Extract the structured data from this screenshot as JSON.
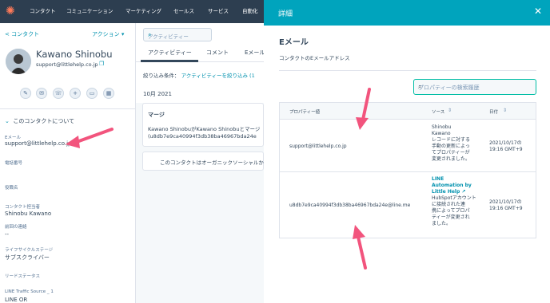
{
  "topnav": {
    "items": [
      "コンタクト",
      "コミュニケーション",
      "マーケティング",
      "セールス",
      "サービス",
      "自動化"
    ]
  },
  "sidebar": {
    "back_label": "< コンタクト",
    "actions_label": "アクション ▾",
    "contact_name": "Kawano Shinobu",
    "contact_email": "support@littlehelp.co.jp",
    "about_title": "このコンタクトについて",
    "fields": [
      {
        "label": "Eメール",
        "value": "support@littlehelp.co.jp"
      },
      {
        "label": "電話番号",
        "value": ""
      },
      {
        "label": "役職名",
        "value": ""
      },
      {
        "label": "コンタクト担当者",
        "value": "Shinobu Kawano"
      },
      {
        "label": "前回の連絡",
        "value": "--"
      },
      {
        "label": "ライフサイクルステージ",
        "value": "サブスクライバー"
      },
      {
        "label": "リードステータス",
        "value": ""
      },
      {
        "label": "LINE Traffic Source _ 1",
        "value": "LINE OR"
      }
    ]
  },
  "middle": {
    "search_placeholder": "アクティビティー",
    "tabs": [
      "アクティビティー",
      "コメント",
      "Eメール"
    ],
    "filter_prefix": "絞り込み条件：",
    "filter_link": "アクティビティーを絞り込み (1",
    "month": "10月 2021",
    "card1_title": "マージ",
    "card1_line1": "Kawano ShinobuがKawano Shinobuとマージ",
    "card1_line2": "(u8db7e9ca40994f3db38ba46967bda24e",
    "card2_text": "このコンタクトはオーガニックソーシャルか"
  },
  "panel": {
    "title": "詳細",
    "section_title": "Eメール",
    "section_desc": "コンタクトのEメールアドレス",
    "history_search_placeholder": "プロパティーの検索履歴",
    "headers": {
      "value": "プロパティー値",
      "source": "ソース",
      "date": "日付"
    },
    "rows": [
      {
        "value": "support@littlehelp.co.jp",
        "source_lines": [
          "Shinobu",
          "Kawano",
          "レコードに対する",
          "手動の更新によっ",
          "てプロパティーが",
          "変更されました。"
        ],
        "date_lines": [
          "2021/10/17の",
          "19:16 GMT+9"
        ]
      },
      {
        "value": "u8db7e9ca40994f3db38ba46967bda24e@line.me",
        "source_link_lines": [
          "LINE",
          "Automation by",
          "Little Help ↗"
        ],
        "source_lines": [
          "HubSpotアカウント",
          "に接続された連",
          "携によってプロパ",
          "ティーが変更され",
          "ました。"
        ],
        "date_lines": [
          "2021/10/17の",
          "19:16 GMT+9"
        ]
      }
    ]
  },
  "colors": {
    "accent": "#00a4bd",
    "nav": "#2d3e50",
    "link": "#0091ae",
    "arrow": "#f2547d"
  }
}
